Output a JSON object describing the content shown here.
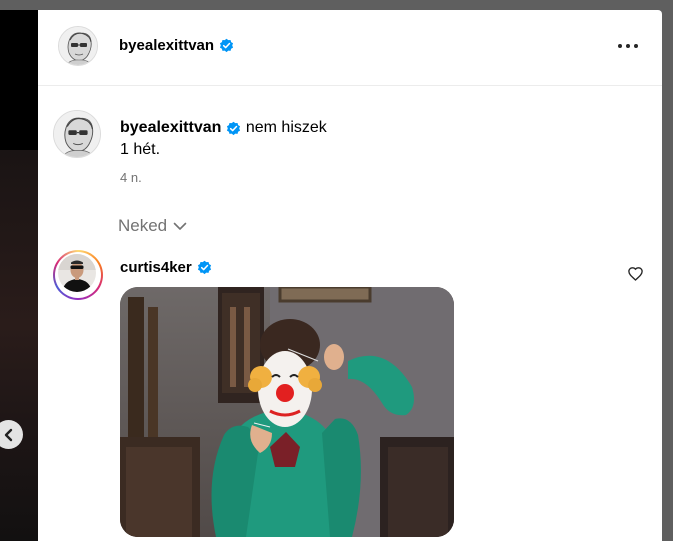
{
  "post": {
    "author": {
      "username": "byealexittvan",
      "verified": true
    },
    "caption": {
      "username": "byealexittvan",
      "text_line1": "nem hiszek",
      "text_line2": "1 hét.",
      "time": "4 n."
    },
    "comments_filter": {
      "label": "Neked"
    }
  },
  "comment": {
    "username": "curtis4ker",
    "verified": true
  },
  "colors": {
    "verified": "#0095f6",
    "secondary_text": "#737373",
    "primary_text": "#000000"
  },
  "icons": [
    "chevron-left-icon",
    "more-options-icon",
    "verified-badge-icon",
    "chevron-down-icon",
    "heart-outline-icon"
  ]
}
